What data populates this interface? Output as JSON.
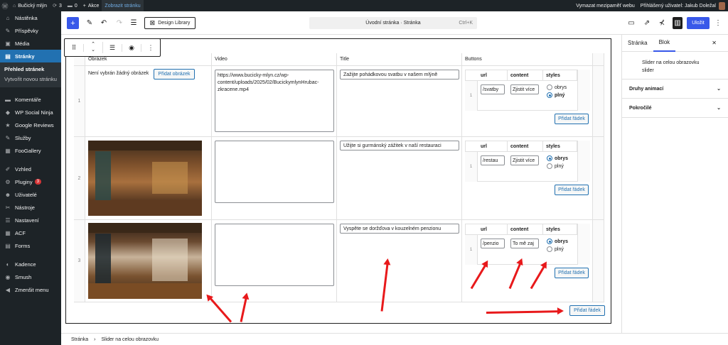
{
  "admin_bar": {
    "site_name": "Bučický mlýn",
    "updates_count": "3",
    "comments_count": "0",
    "new_label": "Akce",
    "view_page": "Zobrazit stránku",
    "clear_cache": "Vymazat mezipaměť webu",
    "logged_in": "Přihlášený uživatel: Jakub Doležal"
  },
  "sidebar": {
    "items": [
      {
        "label": "Nástěnka",
        "icon": "dashboard-icon",
        "glyph": "⌂"
      },
      {
        "label": "Příspěvky",
        "icon": "pin-icon",
        "glyph": "✎"
      },
      {
        "label": "Média",
        "icon": "media-icon",
        "glyph": "▣"
      },
      {
        "label": "Stránky",
        "icon": "pages-icon",
        "glyph": "▤"
      },
      {
        "label": "Komentáře",
        "icon": "comments-icon",
        "glyph": "▬"
      },
      {
        "label": "WP Social Ninja",
        "icon": "ninja-icon",
        "glyph": "◆"
      },
      {
        "label": "Google Reviews",
        "icon": "star-icon",
        "glyph": "★"
      },
      {
        "label": "Služby",
        "icon": "services-icon",
        "glyph": "✎"
      },
      {
        "label": "FooGallery",
        "icon": "gallery-icon",
        "glyph": "▦"
      },
      {
        "label": "Vzhled",
        "icon": "appearance-icon",
        "glyph": "✐"
      },
      {
        "label": "Pluginy",
        "icon": "plugins-icon",
        "glyph": "⚙",
        "badge": "3"
      },
      {
        "label": "Uživatelé",
        "icon": "users-icon",
        "glyph": "☻"
      },
      {
        "label": "Nástroje",
        "icon": "tools-icon",
        "glyph": "✂"
      },
      {
        "label": "Nastavení",
        "icon": "settings-icon",
        "glyph": "☰"
      },
      {
        "label": "ACF",
        "icon": "acf-icon",
        "glyph": "▦"
      },
      {
        "label": "Forms",
        "icon": "forms-icon",
        "glyph": "▤"
      },
      {
        "label": "Kadence",
        "icon": "kadence-icon",
        "glyph": "◐"
      },
      {
        "label": "Smush",
        "icon": "smush-icon",
        "glyph": "◉"
      },
      {
        "label": "Zmenšit menu",
        "icon": "collapse-icon",
        "glyph": "◀"
      }
    ],
    "submenu": {
      "current": "Přehled stránek",
      "new": "Vytvořit novou stránku"
    }
  },
  "toolbar": {
    "design_library": "Design Library",
    "command_title": "Úvodní stránka · Stránka",
    "shortcut": "Ctrl+K",
    "save": "Uložit"
  },
  "panel": {
    "tabs": [
      "Stránka",
      "Blok"
    ],
    "block_title": "Slider na celou obrazovku",
    "block_sub": "slider",
    "sections": [
      "Druhy animací",
      "Pokročilé"
    ]
  },
  "table": {
    "headers": [
      "Obrázek",
      "Video",
      "Title",
      "Buttons"
    ],
    "no_image": "Není vybrán žádný obrázek",
    "add_image": "Přidat obrázek",
    "sub_headers": [
      "url",
      "content",
      "styles"
    ],
    "radio_options": [
      "obrys",
      "plný"
    ],
    "add_row": "Přidat řádek",
    "rows": [
      {
        "num": "1",
        "video": "https://www.bucicky-mlyn.cz/wp-content/uploads/2025/02/BucickymlynHrubac-zkracene.mp4",
        "title": "Zažijte pohádkovou svatbu v našem mlýně",
        "url": "/svatby",
        "content": "Zjistit více",
        "style": "plný"
      },
      {
        "num": "2",
        "video": "",
        "title": "Užijte si gurmánský zážitek v naší restauraci",
        "url": "/restau",
        "content": "Zjistit více",
        "style": "obrys"
      },
      {
        "num": "3",
        "video": "",
        "title": "Vyspěte se doržďova v kouzelném penzionu",
        "url": "/penzio",
        "content": "To mě zaj",
        "style": "obrys"
      }
    ]
  },
  "breadcrumb": [
    "Stránka",
    "Slider na celou obrazovku"
  ],
  "colors": {
    "accent": "#3858e9",
    "admin_bg": "#1d2327",
    "active_menu": "#2271b1",
    "arrow": "#e8191b"
  }
}
